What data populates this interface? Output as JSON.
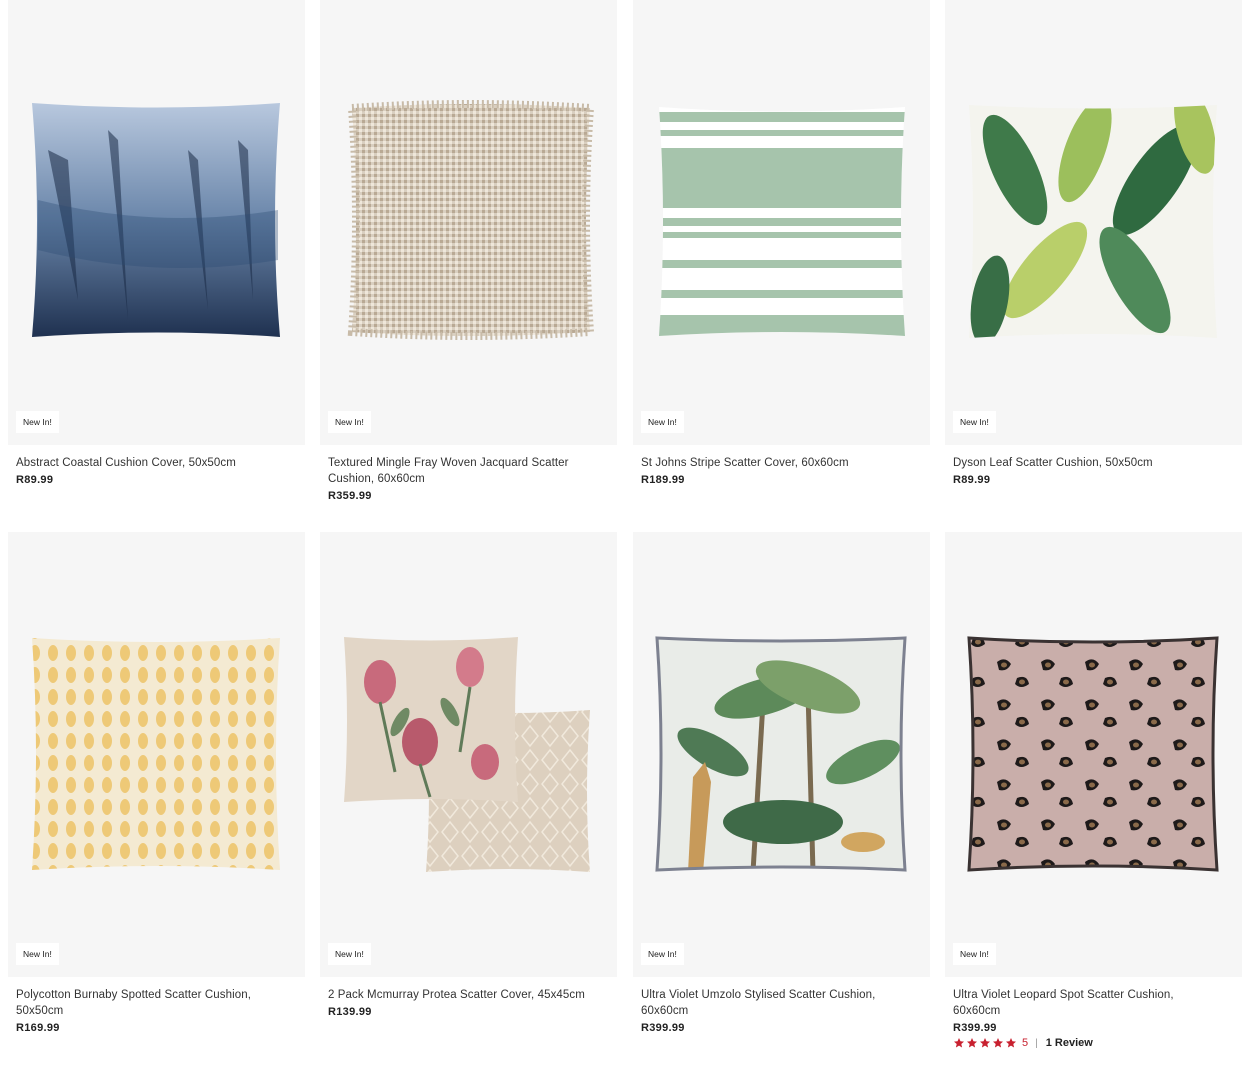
{
  "products": [
    {
      "badge": "New In!",
      "name": "Abstract Coastal Cushion Cover, 50x50cm",
      "price": "R89.99"
    },
    {
      "badge": "New In!",
      "name": "Textured Mingle Fray Woven Jacquard Scatter Cushion, 60x60cm",
      "price": "R359.99"
    },
    {
      "badge": "New In!",
      "name": "St Johns Stripe Scatter Cover, 60x60cm",
      "price": "R189.99"
    },
    {
      "badge": "New In!",
      "name": "Dyson Leaf Scatter Cushion, 50x50cm",
      "price": "R89.99"
    },
    {
      "badge": "New In!",
      "name": "Polycotton Burnaby Spotted Scatter Cushion, 50x50cm",
      "price": "R169.99"
    },
    {
      "badge": "New In!",
      "name": "2 Pack Mcmurray Protea Scatter Cover, 45x45cm",
      "price": "R139.99"
    },
    {
      "badge": "New In!",
      "name": "Ultra Violet Umzolo Stylised Scatter Cushion, 60x60cm",
      "price": "R399.99"
    },
    {
      "badge": "New In!",
      "name": "Ultra Violet Leopard Spot Scatter Cushion, 60x60cm",
      "price": "R399.99",
      "rating": {
        "stars": 5,
        "value": "5",
        "separator": "|",
        "reviews": "1 Review"
      }
    }
  ],
  "colors": {
    "star": "#c8202f",
    "card_bg": "#f6f6f6"
  }
}
